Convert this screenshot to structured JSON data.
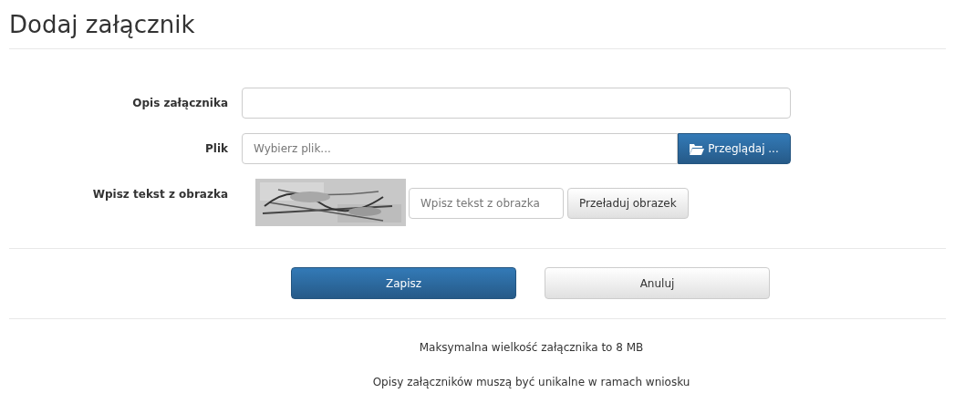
{
  "title": "Dodaj załącznik",
  "fields": [
    {
      "kind": "text",
      "label": "Opis załącznika"
    },
    {
      "kind": "file",
      "label": "Plik",
      "placeholder": "Wybierz plik...",
      "button": "Przeglądaj ..."
    },
    {
      "kind": "captcha",
      "label": "Wpisz tekst z obrazka",
      "placeholder": "Wpisz tekst z obrazka",
      "button": "Przeładuj obrazek"
    }
  ],
  "actions": [
    {
      "label": "Zapisz",
      "primary": true
    },
    {
      "label": "Anuluj",
      "primary": false
    }
  ],
  "notes": [
    "Maksymalna wielkość załącznika to 8 MB",
    "Opisy załączników muszą być unikalne w ramach wniosku"
  ]
}
